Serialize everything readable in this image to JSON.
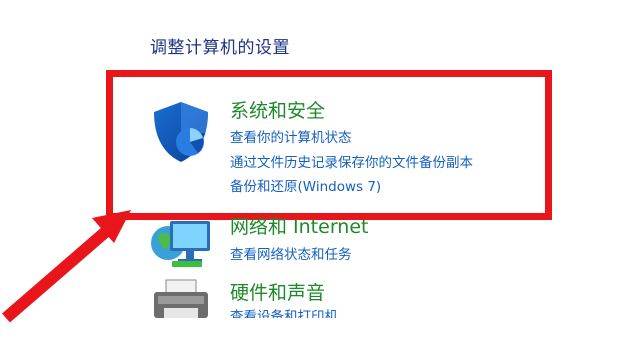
{
  "page": {
    "title": "调整计算机的设置"
  },
  "categories": [
    {
      "title": "系统和安全",
      "links": [
        "查看你的计算机状态",
        "通过文件历史记录保存你的文件备份副本",
        "备份和还原(Windows 7)"
      ]
    },
    {
      "title": "网络和 Internet",
      "links": [
        "查看网络状态和任务"
      ]
    },
    {
      "title": "硬件和声音",
      "links": [
        "查看设备和打印机"
      ]
    }
  ],
  "colors": {
    "highlight": "#e8161b",
    "category_title": "#1d8a2a",
    "link": "#1560c0",
    "page_title": "#1e3287"
  },
  "icons": [
    "shield-icon",
    "network-icon",
    "printer-icon",
    "arrow-annotation"
  ]
}
